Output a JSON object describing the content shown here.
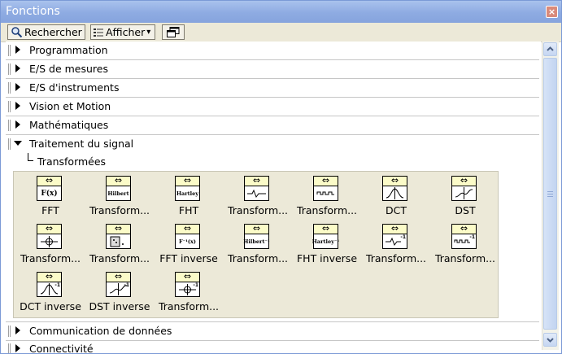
{
  "window": {
    "title": "Fonctions",
    "close_glyph": "×"
  },
  "toolbar": {
    "search_label": "Rechercher",
    "view_label": "Afficher",
    "view_arrow": "▾"
  },
  "categories": [
    {
      "label": "Programmation",
      "expanded": false
    },
    {
      "label": "E/S de mesures",
      "expanded": false
    },
    {
      "label": "E/S d'instruments",
      "expanded": false
    },
    {
      "label": "Vision et Motion",
      "expanded": false
    },
    {
      "label": "Mathématiques",
      "expanded": false
    },
    {
      "label": "Traitement du signal",
      "expanded": true
    },
    {
      "label": "Communication de données",
      "expanded": false
    },
    {
      "label": "Connectivité",
      "expanded": false
    }
  ],
  "subpalette": {
    "label": "Transformées"
  },
  "palette_items": [
    {
      "label": "FFT",
      "icon": "fft-icon",
      "glyph": "F(x)"
    },
    {
      "label": "Transform...",
      "icon": "hilbert-icon",
      "glyph": "Hilbert"
    },
    {
      "label": "FHT",
      "icon": "hartley-icon",
      "glyph": "Hartley"
    },
    {
      "label": "Transform...",
      "icon": "wavelet-icon",
      "glyph": ""
    },
    {
      "label": "Transform...",
      "icon": "walsh-icon",
      "glyph": ""
    },
    {
      "label": "DCT",
      "icon": "dct-icon",
      "glyph": ""
    },
    {
      "label": "DST",
      "icon": "dst-icon",
      "glyph": ""
    },
    {
      "label": "Transform...",
      "icon": "chirp-icon",
      "glyph": ""
    },
    {
      "label": "Transform...",
      "icon": "fft-2d-icon",
      "glyph": ""
    },
    {
      "label": "FFT inverse",
      "icon": "inverse-fft-icon",
      "glyph": "F⁻¹(x)"
    },
    {
      "label": "Transform...",
      "icon": "inverse-hilbert-icon",
      "glyph": "Hilbert⁻¹"
    },
    {
      "label": "FHT inverse",
      "icon": "inverse-hartley-icon",
      "glyph": "Hartley⁻¹"
    },
    {
      "label": "Transform...",
      "icon": "inverse-wavelet-icon",
      "glyph": ""
    },
    {
      "label": "Transform...",
      "icon": "inverse-walsh-icon",
      "glyph": ""
    },
    {
      "label": "DCT inverse",
      "icon": "inverse-dct-icon",
      "glyph": ""
    },
    {
      "label": "DST inverse",
      "icon": "inverse-dst-icon",
      "glyph": ""
    },
    {
      "label": "Transform...",
      "icon": "inverse-chirp-icon",
      "glyph": ""
    }
  ],
  "colors": {
    "titlebar": "#8eabe2",
    "icon_header": "#fbfbc8",
    "palette_bg": "#ece9d8"
  }
}
